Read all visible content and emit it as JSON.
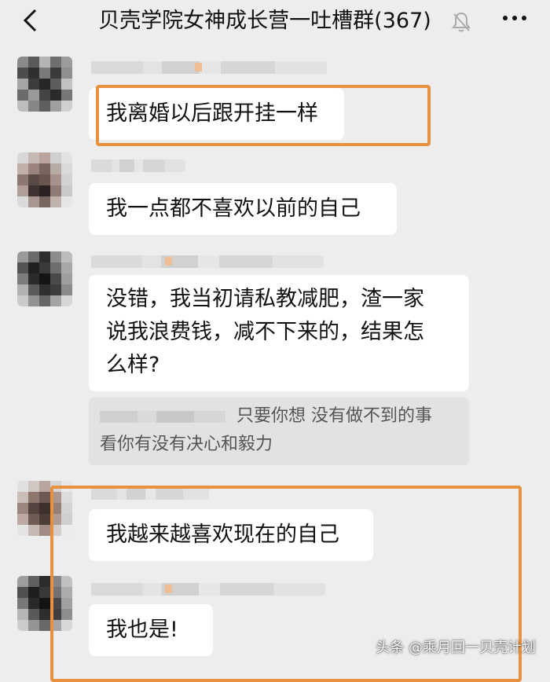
{
  "header": {
    "title": "贝壳学院女神成长营一吐槽群(367)",
    "back_icon": "chevron-left",
    "mute_icon": "bell-muted",
    "more_icon": "more-dots"
  },
  "messages": [
    {
      "text": "我离婚以后跟开挂一样",
      "highlighted": true
    },
    {
      "text": "我一点都不喜欢以前的自己"
    },
    {
      "lines": [
        "没错，我当初请私教减肥，渣一家",
        "说我浪费钱，减不下来的，结果怎",
        "么样?"
      ]
    },
    {
      "text": "我越来越喜欢现在的自己"
    },
    {
      "text": "我也是!"
    }
  ],
  "quote": {
    "line1": "只要你想 没有做不到的事",
    "line2": "看你有没有决心和毅力"
  },
  "highlight_color": "#e8913f",
  "watermark": "头条 @乘月回一贝壳计划"
}
